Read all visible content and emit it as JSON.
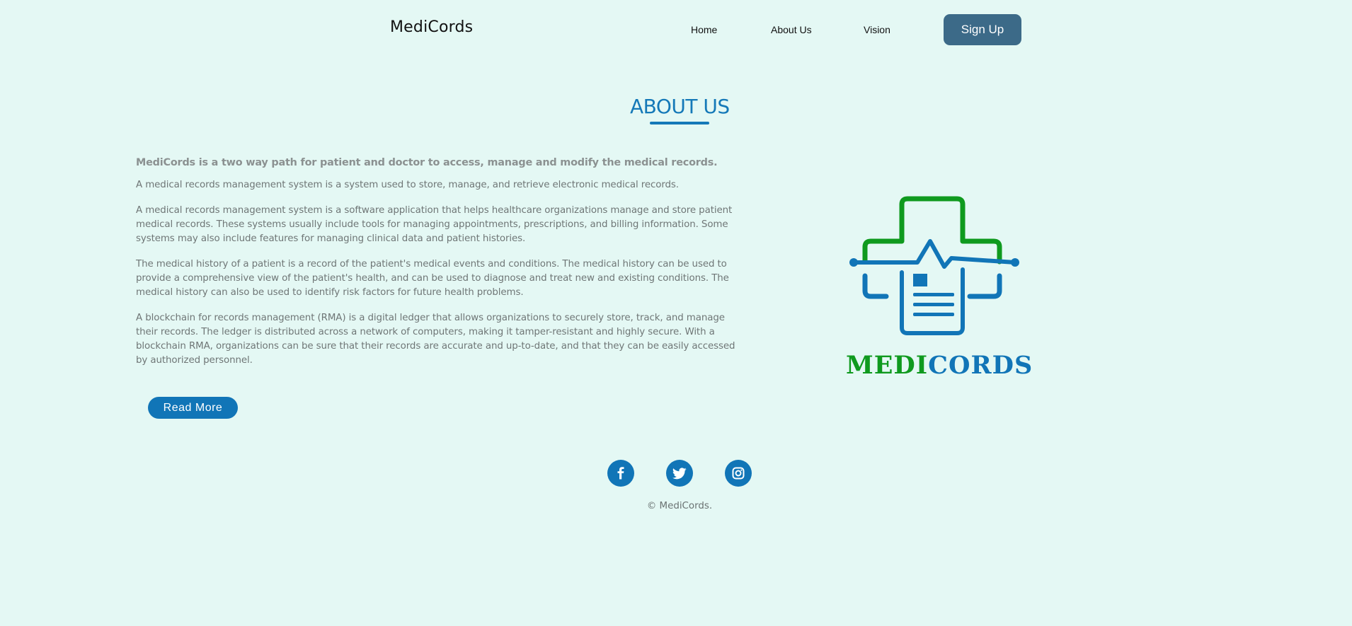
{
  "header": {
    "brand": "MediCords",
    "nav": {
      "home": "Home",
      "about": "About Us",
      "vision": "Vision"
    },
    "signup_label": "Sign Up"
  },
  "about": {
    "title": "ABOUT US",
    "lead": "MediCords is a two way path for patient and doctor to access, manage and modify the medical records.",
    "paragraphs": [
      "A medical records management system is a system used to store, manage, and retrieve electronic medical records.",
      "A medical records management system is a software application that helps healthcare organizations manage and store patient medical records. These systems usually include tools for managing appointments, prescriptions, and billing information. Some systems may also include features for managing clinical data and patient histories.",
      "The medical history of a patient is a record of the patient's medical events and conditions. The medical history can be used to provide a comprehensive view of the patient's health, and can be used to diagnose and treat new and existing conditions. The medical history can also be used to identify risk factors for future health problems.",
      "A blockchain for records management (RMA) is a digital ledger that allows organizations to securely store, track, and manage their records. The ledger is distributed across a network of computers, making it tamper-resistant and highly secure. With a blockchain RMA, organizations can be sure that their records are accurate and up-to-date, and that they can be easily accessed by authorized personnel."
    ],
    "read_more_label": "Read More"
  },
  "logo": {
    "word_part1": "MEDI",
    "word_part2": "CORDS",
    "colors": {
      "green": "#0f9a1e",
      "blue": "#1175b7"
    }
  },
  "social": {
    "icons": [
      "facebook-icon",
      "twitter-icon",
      "instagram-icon"
    ]
  },
  "footer": {
    "copyright": "© MediCords."
  },
  "colors": {
    "background": "#e4f8f4",
    "accent": "#1175b7",
    "signup": "#3c6a88"
  }
}
